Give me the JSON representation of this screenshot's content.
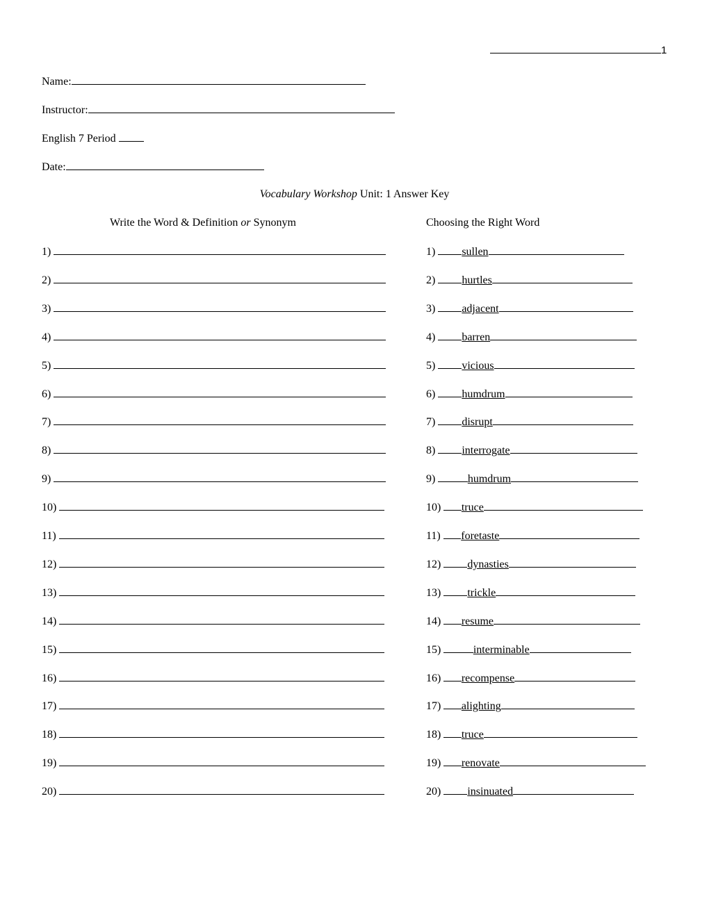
{
  "page_number": "1",
  "header_fields": [
    {
      "label": "Name:"
    },
    {
      "label": "Instructor:"
    },
    {
      "label": "English 7 Period"
    },
    {
      "label": "Date:"
    }
  ],
  "title": {
    "italic": "Vocabulary Workshop",
    "rest": " Unit: 1 Answer Key"
  },
  "left_column": {
    "heading_pre": "Write the Word & Definition ",
    "heading_italic": "or",
    "heading_post": " Synonym",
    "items": [
      "1)",
      "2)",
      "3)",
      "4)",
      "5)",
      "6)",
      "7)",
      "8)",
      "9)",
      "10)",
      "11)",
      "12)",
      "13)",
      "14)",
      "15)",
      "16)",
      "17)",
      "18)",
      "19)",
      "20)"
    ]
  },
  "right_column": {
    "heading": "Choosing the Right Word",
    "items": [
      {
        "num": "1)",
        "answer": "sullen"
      },
      {
        "num": "2)",
        "answer": "hurtles"
      },
      {
        "num": "3)",
        "answer": "adjacent"
      },
      {
        "num": "4)",
        "answer": "barren"
      },
      {
        "num": "5)",
        "answer": "vicious"
      },
      {
        "num": "6)",
        "answer": "humdrum"
      },
      {
        "num": "7)",
        "answer": "disrupt"
      },
      {
        "num": "8)",
        "answer": "interrogate"
      },
      {
        "num": "9)",
        "answer": "humdrum"
      },
      {
        "num": "10)",
        "answer": "truce"
      },
      {
        "num": "11)",
        "answer": "foretaste"
      },
      {
        "num": "12)",
        "answer": "dynasties"
      },
      {
        "num": "13)",
        "answer": "trickle"
      },
      {
        "num": "14)",
        "answer": "resume"
      },
      {
        "num": "15)",
        "answer": "interminable"
      },
      {
        "num": "16)",
        "answer": "recompense"
      },
      {
        "num": "17)",
        "answer": "alighting"
      },
      {
        "num": "18)",
        "answer": "truce"
      },
      {
        "num": "19)",
        "answer": "renovate"
      },
      {
        "num": "20)",
        "answer": "insinuated"
      }
    ]
  }
}
